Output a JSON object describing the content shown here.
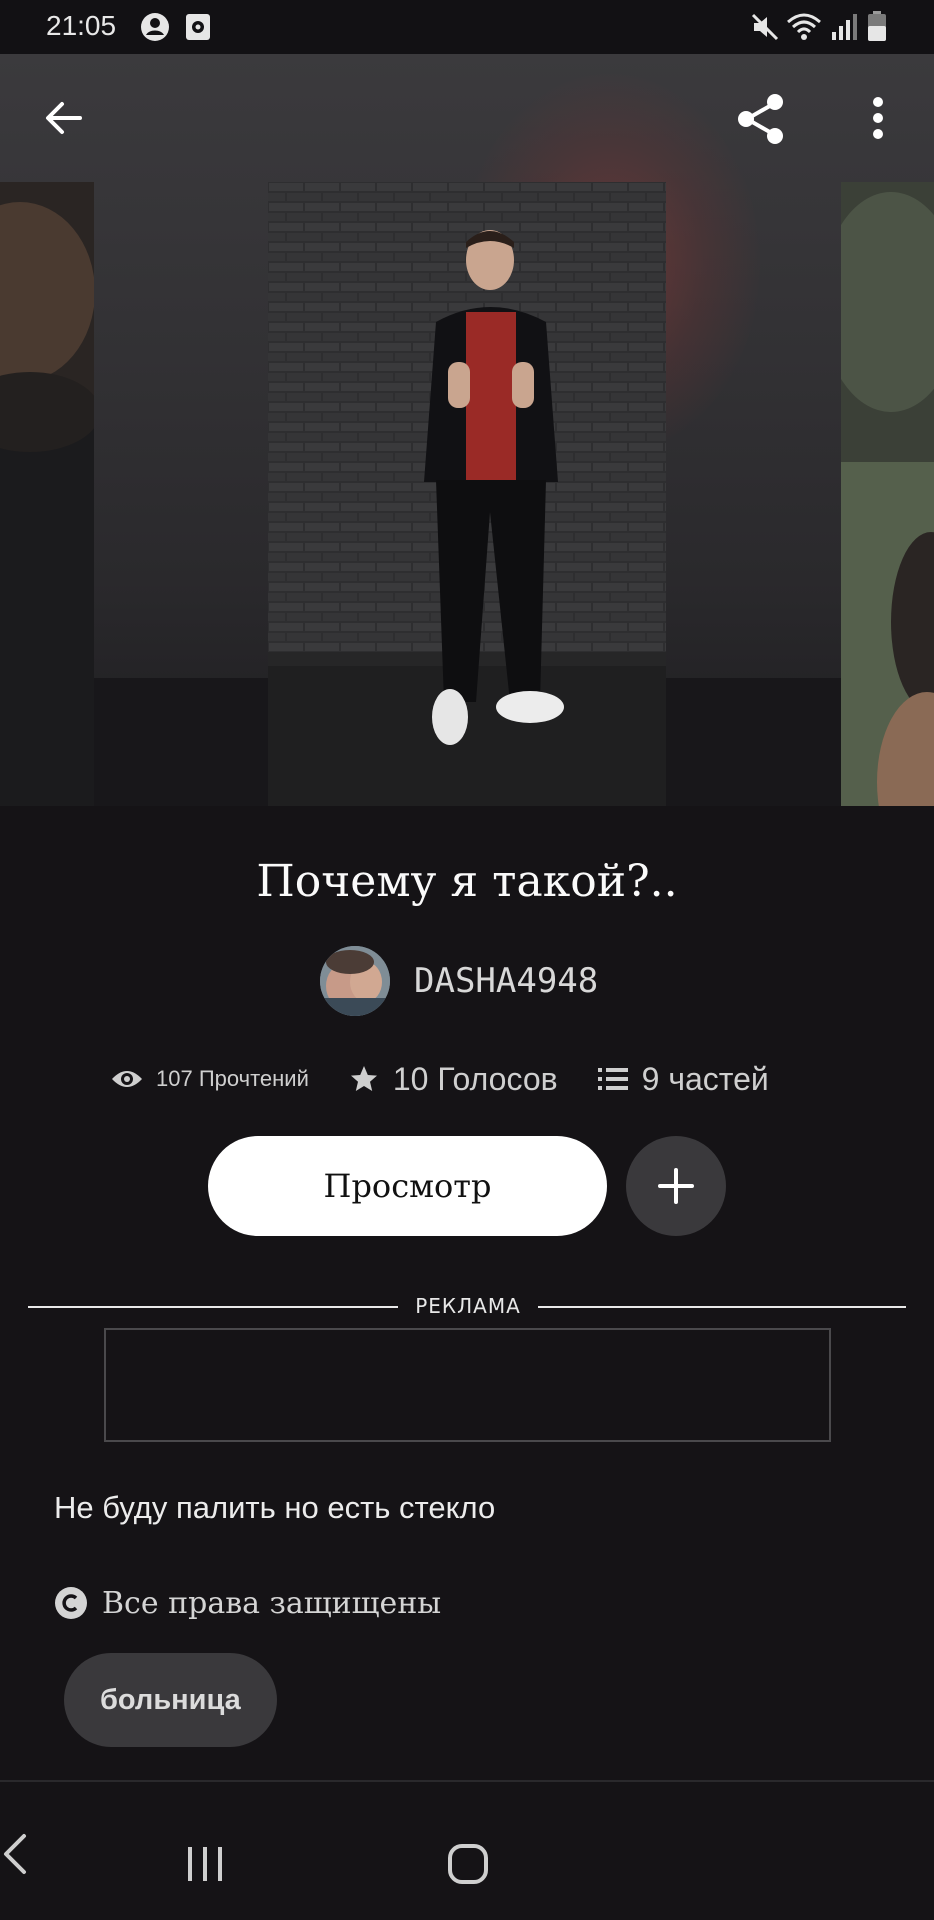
{
  "status_bar": {
    "time": "21:05",
    "icons": [
      "account-circle-icon",
      "screen-record-icon",
      "mute-icon",
      "wifi-icon",
      "signal-icon",
      "battery-icon"
    ]
  },
  "app_bar": {
    "back_icon": "arrow-left-icon",
    "share_icon": "share-icon",
    "more_icon": "more-vert-icon"
  },
  "story": {
    "title": "Почему я такой?..",
    "author": "DASHA4948",
    "stats": {
      "reads": "107 Прочтений",
      "votes": "10 Голосов",
      "parts": "9 частей"
    },
    "read_button": "Просмотр",
    "add_button_icon": "plus-icon",
    "ad_label": "РЕКЛАМА",
    "description": "Не буду палить но есть стекло",
    "copyright": "Все права защищены",
    "tags": [
      "больница"
    ]
  },
  "nav_bar": {
    "icons": [
      "recent-apps-icon",
      "home-icon",
      "back-icon"
    ]
  },
  "colors": {
    "background": "#151316",
    "button_light": "#ffffff",
    "chip": "#3a393c"
  }
}
